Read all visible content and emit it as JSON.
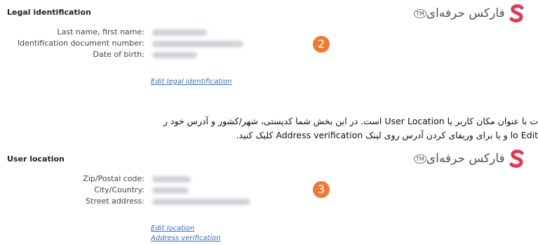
{
  "brand": {
    "logo_text": "فارکس حرفه‌ای",
    "tm": "TM",
    "accent": "#e03a52",
    "badge_color": "#ec7b35"
  },
  "legal": {
    "title": "Legal identification",
    "labels": [
      "Last name, first name:",
      "Identification document number:",
      "Date of birth:"
    ],
    "badge": "2",
    "edit_link": "Edit legal identification"
  },
  "paragraph": {
    "line1": "ت با عنوان مکان کاربر یا User Location است. در این بخش شما کدپستی، شهر/کشور و آدرس خود ر",
    "line2": "lo Edit و یا برای وریفای کردن آدرس روی لینک Address verification کلیک کنید."
  },
  "location": {
    "title": "User location",
    "labels": [
      "Zip/Postal code:",
      "City/Country:",
      "Street address:"
    ],
    "badge": "3",
    "edit_link": "Edit location",
    "verify_link": "Address verification"
  }
}
